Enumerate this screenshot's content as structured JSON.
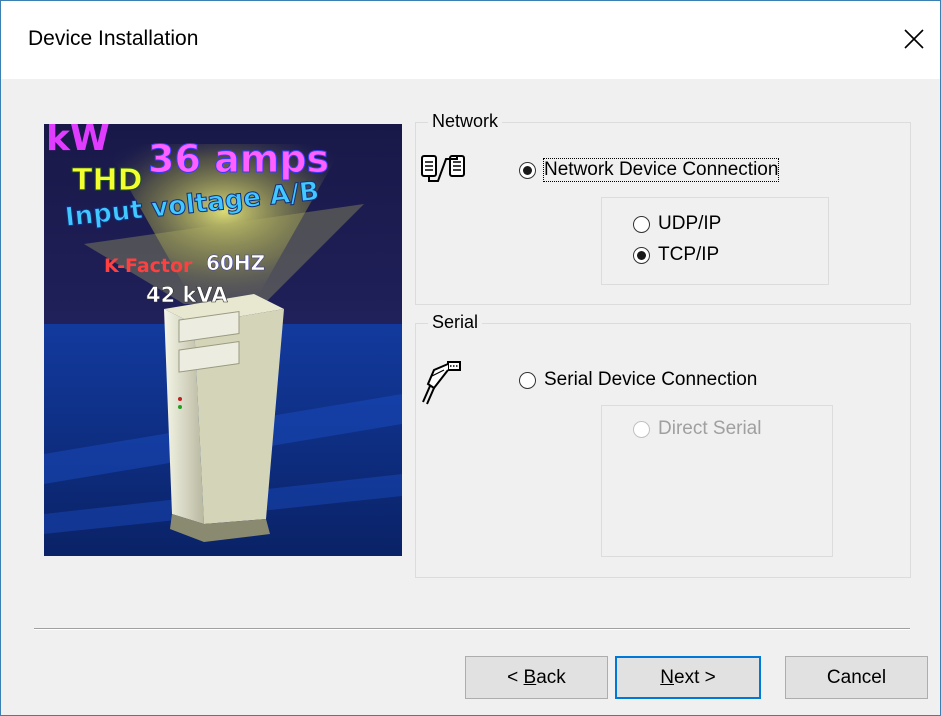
{
  "window": {
    "title": "Device Installation"
  },
  "banner": {
    "texts": {
      "kw": "kW",
      "amps": "36 amps",
      "thd": "THD",
      "input": "Input voltage A/B",
      "kfactor": "K-Factor",
      "hz": "60HZ",
      "kva": "42 kVA"
    }
  },
  "network": {
    "group_label": "Network",
    "connection_label": "Network Device Connection",
    "connection_selected": true,
    "protocols": [
      {
        "label": "UDP/IP",
        "selected": false
      },
      {
        "label": "TCP/IP",
        "selected": true
      }
    ]
  },
  "serial": {
    "group_label": "Serial",
    "connection_label": "Serial Device Connection",
    "connection_selected": false,
    "options": [
      {
        "label": "Direct Serial",
        "selected": false,
        "disabled": true
      }
    ]
  },
  "buttons": {
    "back_pre": "< ",
    "back_ul": "B",
    "back_post": "ack",
    "next_ul": "N",
    "next_post": "ext >",
    "cancel": "Cancel"
  },
  "colors": {
    "accent": "#0078d7",
    "window_border": "#3c7fb1"
  },
  "icons": {
    "close": "close-icon",
    "network": "network-connection-icon",
    "serial": "serial-cable-icon"
  }
}
